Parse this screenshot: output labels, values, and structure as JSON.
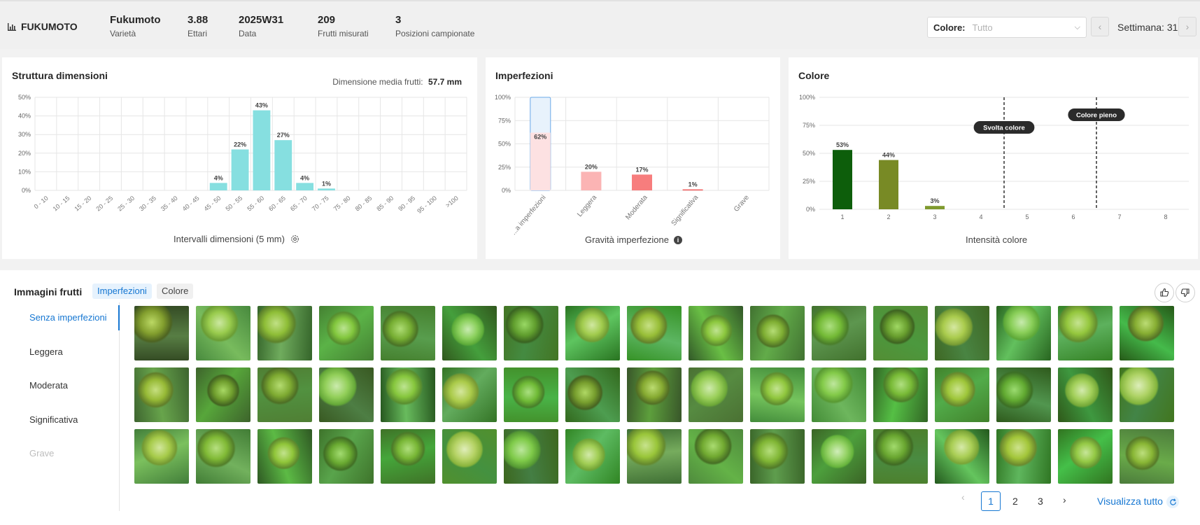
{
  "header": {
    "title": "FUKUMOTO",
    "stats": [
      {
        "value": "Fukumoto",
        "label": "Varietà"
      },
      {
        "value": "3.88",
        "label": "Ettari"
      },
      {
        "value": "2025W31",
        "label": "Data"
      },
      {
        "value": "209",
        "label": "Frutti misurati"
      },
      {
        "value": "3",
        "label": "Posizioni campionate"
      }
    ],
    "color_filter": {
      "label": "Colore:",
      "value": "Tutto"
    },
    "week": "Settimana: 31"
  },
  "size_card": {
    "title": "Struttura dimensioni",
    "avg_label": "Dimensione media frutti:",
    "avg_value": "57.7 mm",
    "xlabel": "Intervalli dimensioni (5 mm)"
  },
  "imperf_card": {
    "title": "Imperfezioni",
    "xlabel": "Gravità imperfezione"
  },
  "color_card": {
    "title": "Colore",
    "xlabel": "Intensità colore",
    "marker1": "Svolta colore",
    "marker2": "Colore pieno"
  },
  "chart_data": [
    {
      "type": "bar",
      "categories": [
        "0 - 10",
        "10 - 15",
        "15 - 20",
        "20 - 25",
        "25 - 30",
        "30 - 35",
        "35 - 40",
        "40 - 45",
        "45 - 50",
        "50 - 55",
        "55 - 60",
        "60 - 65",
        "65 - 70",
        "70 - 75",
        "75 - 80",
        "80 - 85",
        "85 - 90",
        "90 - 95",
        "95 - 100",
        ">100"
      ],
      "values": [
        0,
        0,
        0,
        0,
        0,
        0,
        0,
        0,
        4,
        22,
        43,
        27,
        4,
        1,
        0,
        0,
        0,
        0,
        0,
        0
      ],
      "labels": [
        "",
        "",
        "",
        "",
        "",
        "",
        "",
        "",
        "4%",
        "22%",
        "43%",
        "27%",
        "4%",
        "1%",
        "",
        "",
        "",
        "",
        "",
        ""
      ],
      "ticks": [
        "0%",
        "10%",
        "20%",
        "30%",
        "40%",
        "50%"
      ],
      "xlabel": "Intervalli dimensioni (5 mm)",
      "ylim": [
        0,
        50
      ],
      "color": "#86dfe0"
    },
    {
      "type": "bar",
      "categories": [
        "Senza imperfezioni",
        "Leggera",
        "Moderata",
        "Significativa",
        "Grave"
      ],
      "tick_labels": [
        "...a imperfezioni",
        "Leggera",
        "Moderata",
        "Significativa",
        "Grave"
      ],
      "values": [
        62,
        20,
        17,
        1,
        0
      ],
      "labels": [
        "62%",
        "20%",
        "17%",
        "1%",
        ""
      ],
      "ticks": [
        "0%",
        "25%",
        "50%",
        "75%",
        "100%"
      ],
      "xlabel": "Gravità imperfezione",
      "ylim": [
        0,
        100
      ],
      "colors": [
        "#fde1e2",
        "#fbb4b4",
        "#f77d7d",
        "#f04a4a",
        "#d92c2c"
      ]
    },
    {
      "type": "bar",
      "categories": [
        "1",
        "2",
        "3",
        "4",
        "5",
        "6",
        "7",
        "8"
      ],
      "values": [
        53,
        44,
        3,
        0,
        0,
        0,
        0,
        0
      ],
      "labels": [
        "53%",
        "44%",
        "3%",
        "",
        "",
        "",
        "",
        ""
      ],
      "ticks": [
        "0%",
        "25%",
        "50%",
        "75%",
        "100%"
      ],
      "xlabel": "Intensità colore",
      "ylim": [
        0,
        100
      ],
      "colors": [
        "#0d5e0b",
        "#788a25",
        "#7f9a2e",
        "#a5b33c",
        "#c4c444",
        "#d8c44a",
        "#e0b54b",
        "#e89a3a"
      ],
      "markers": [
        {
          "label": "Svolta colore",
          "x": 4.5
        },
        {
          "label": "Colore pieno",
          "x": 6.5
        }
      ]
    }
  ],
  "images": {
    "title": "Immagini frutti",
    "tabs": [
      "Imperfezioni",
      "Colore"
    ],
    "categories": [
      "Senza imperfezioni",
      "Leggera",
      "Moderata",
      "Significativa",
      "Grave"
    ],
    "count": 51
  },
  "pagination": {
    "pages": [
      "1",
      "2",
      "3"
    ],
    "prev": "‹",
    "next": "›",
    "view_all": "Visualizza tutto"
  }
}
